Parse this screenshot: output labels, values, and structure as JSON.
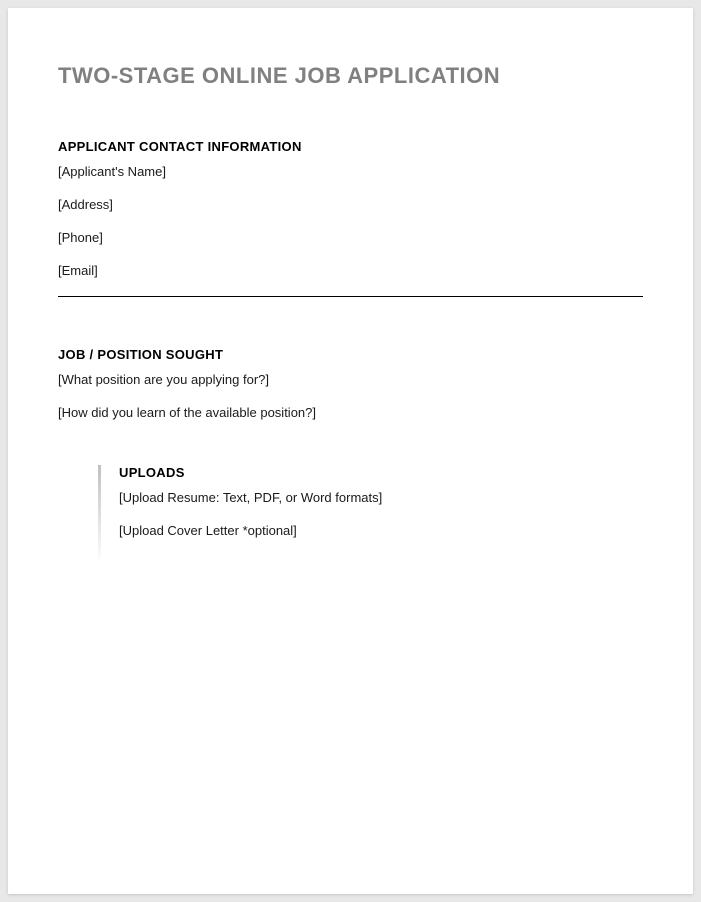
{
  "title": "TWO-STAGE ONLINE JOB APPLICATION",
  "contact": {
    "heading": "APPLICANT CONTACT INFORMATION",
    "fields": {
      "name": "[Applicant's Name]",
      "address": "[Address]",
      "phone": "[Phone]",
      "email": "[Email]"
    }
  },
  "job": {
    "heading": "JOB / POSITION SOUGHT",
    "fields": {
      "position": "[What position are you applying for?]",
      "source": "[How did you learn of the available position?]"
    }
  },
  "uploads": {
    "heading": "UPLOADS",
    "fields": {
      "resume": "[Upload Resume: Text, PDF, or Word formats]",
      "cover_letter": "[Upload Cover Letter *optional]"
    }
  }
}
